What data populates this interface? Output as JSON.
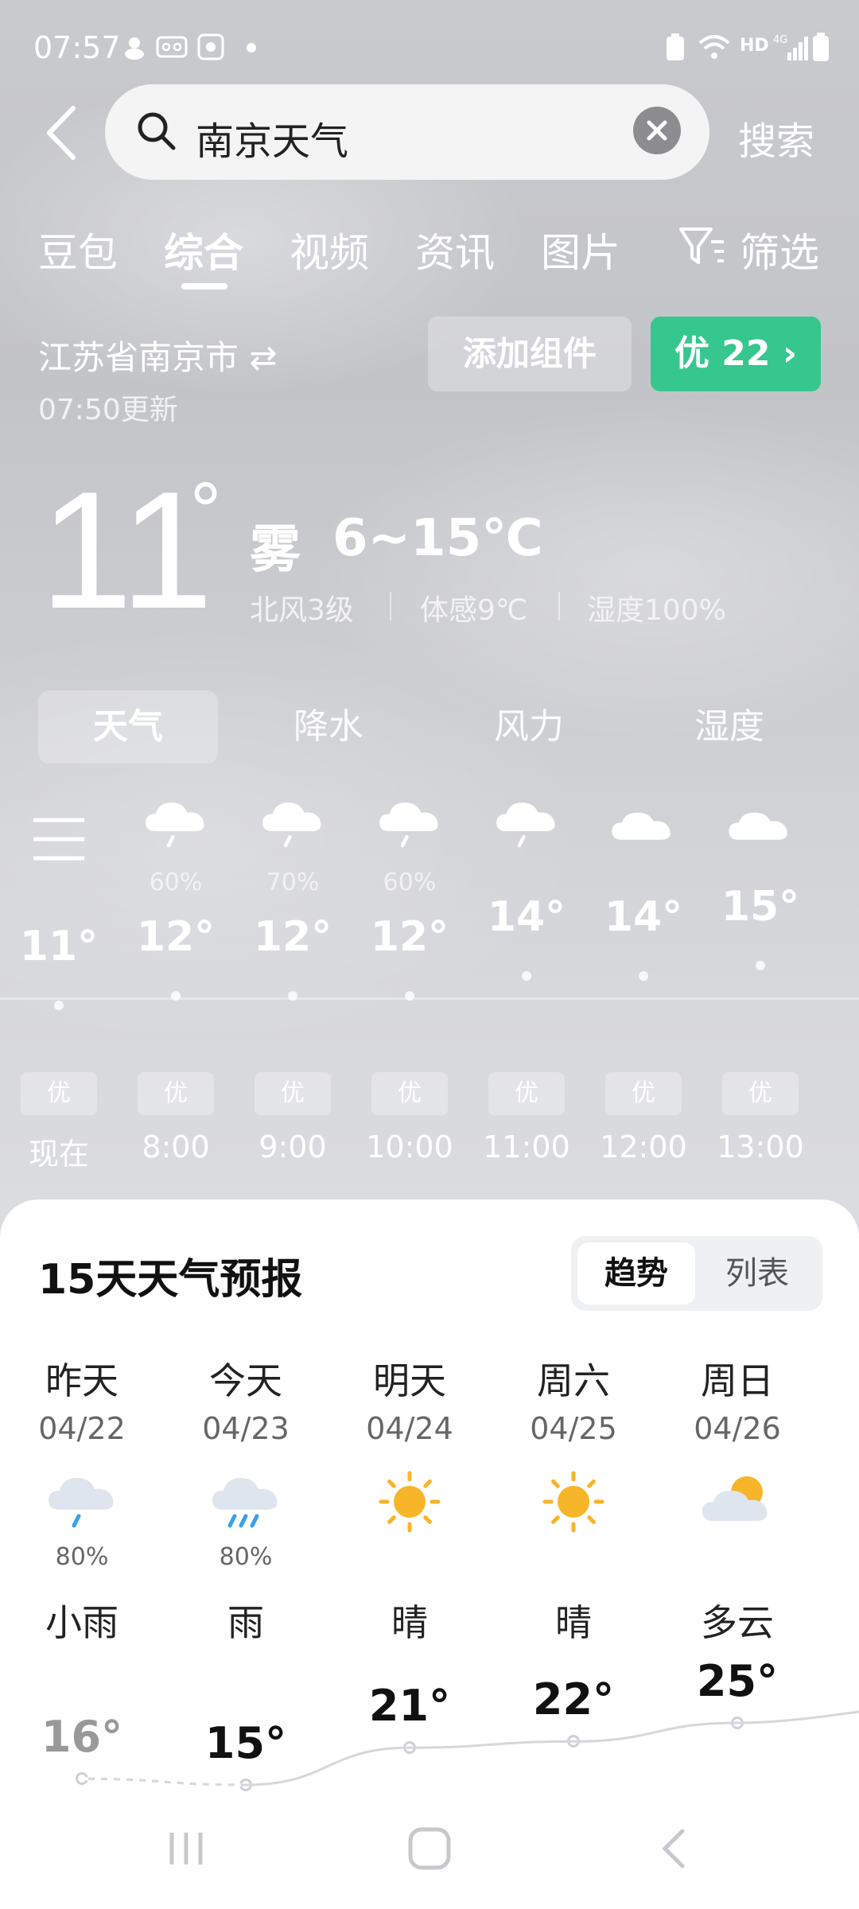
{
  "status": {
    "time": "07:57"
  },
  "search": {
    "query": "南京天气",
    "button": "搜索"
  },
  "tabs": [
    "豆包",
    "综合",
    "视频",
    "资讯",
    "图片",
    "筛选"
  ],
  "location": {
    "name": "江苏省南京市",
    "updated": "07:50更新",
    "add_widget": "添加组件",
    "aqi": "优 22"
  },
  "current": {
    "temp": "11",
    "degree": "°",
    "condition": "雾",
    "range": "6~15℃",
    "wind": "北风3级",
    "feels": "体感9℃",
    "humidity": "湿度100%"
  },
  "chips": [
    "天气",
    "降水",
    "风力",
    "湿度"
  ],
  "hourly": [
    {
      "time": "现在",
      "temp": "11°",
      "temp_value": 11,
      "aqi": "优",
      "icon": "none",
      "precip": ""
    },
    {
      "time": "8:00",
      "temp": "12°",
      "temp_value": 12,
      "aqi": "优",
      "icon": "cloud-rain-icon",
      "precip": "60%"
    },
    {
      "time": "9:00",
      "temp": "12°",
      "temp_value": 12,
      "aqi": "优",
      "icon": "cloud-rain-icon",
      "precip": "70%"
    },
    {
      "time": "10:00",
      "temp": "12°",
      "temp_value": 12,
      "aqi": "优",
      "icon": "cloud-rain-icon",
      "precip": "60%"
    },
    {
      "time": "11:00",
      "temp": "14°",
      "temp_value": 14,
      "aqi": "优",
      "icon": "cloud-rain-icon",
      "precip": ""
    },
    {
      "time": "12:00",
      "temp": "14°",
      "temp_value": 14,
      "aqi": "优",
      "icon": "cloud-icon",
      "precip": ""
    },
    {
      "time": "13:00",
      "temp": "15°",
      "temp_value": 15,
      "aqi": "优",
      "icon": "cloud-icon",
      "precip": ""
    }
  ],
  "forecast": {
    "title": "15天天气预报",
    "toggle": {
      "trend": "趋势",
      "list": "列表"
    },
    "days": [
      {
        "name": "昨天",
        "date": "04/22",
        "icon": "cloud-rain-icon",
        "precip": "80%",
        "condition": "小雨",
        "high": "16°",
        "high_value": 16
      },
      {
        "name": "今天",
        "date": "04/23",
        "icon": "cloud-heavy-rain-icon",
        "precip": "80%",
        "condition": "雨",
        "high": "15°",
        "high_value": 15
      },
      {
        "name": "明天",
        "date": "04/24",
        "icon": "sun-icon",
        "precip": "",
        "condition": "晴",
        "high": "21°",
        "high_value": 21
      },
      {
        "name": "周六",
        "date": "04/25",
        "icon": "sun-icon",
        "precip": "",
        "condition": "晴",
        "high": "22°",
        "high_value": 22
      },
      {
        "name": "周日",
        "date": "04/26",
        "icon": "partly-cloudy-icon",
        "precip": "",
        "condition": "多云",
        "high": "25°",
        "high_value": 25
      }
    ]
  },
  "colors": {
    "aqi_green": "#35c78e",
    "sun": "#f7b52a"
  }
}
